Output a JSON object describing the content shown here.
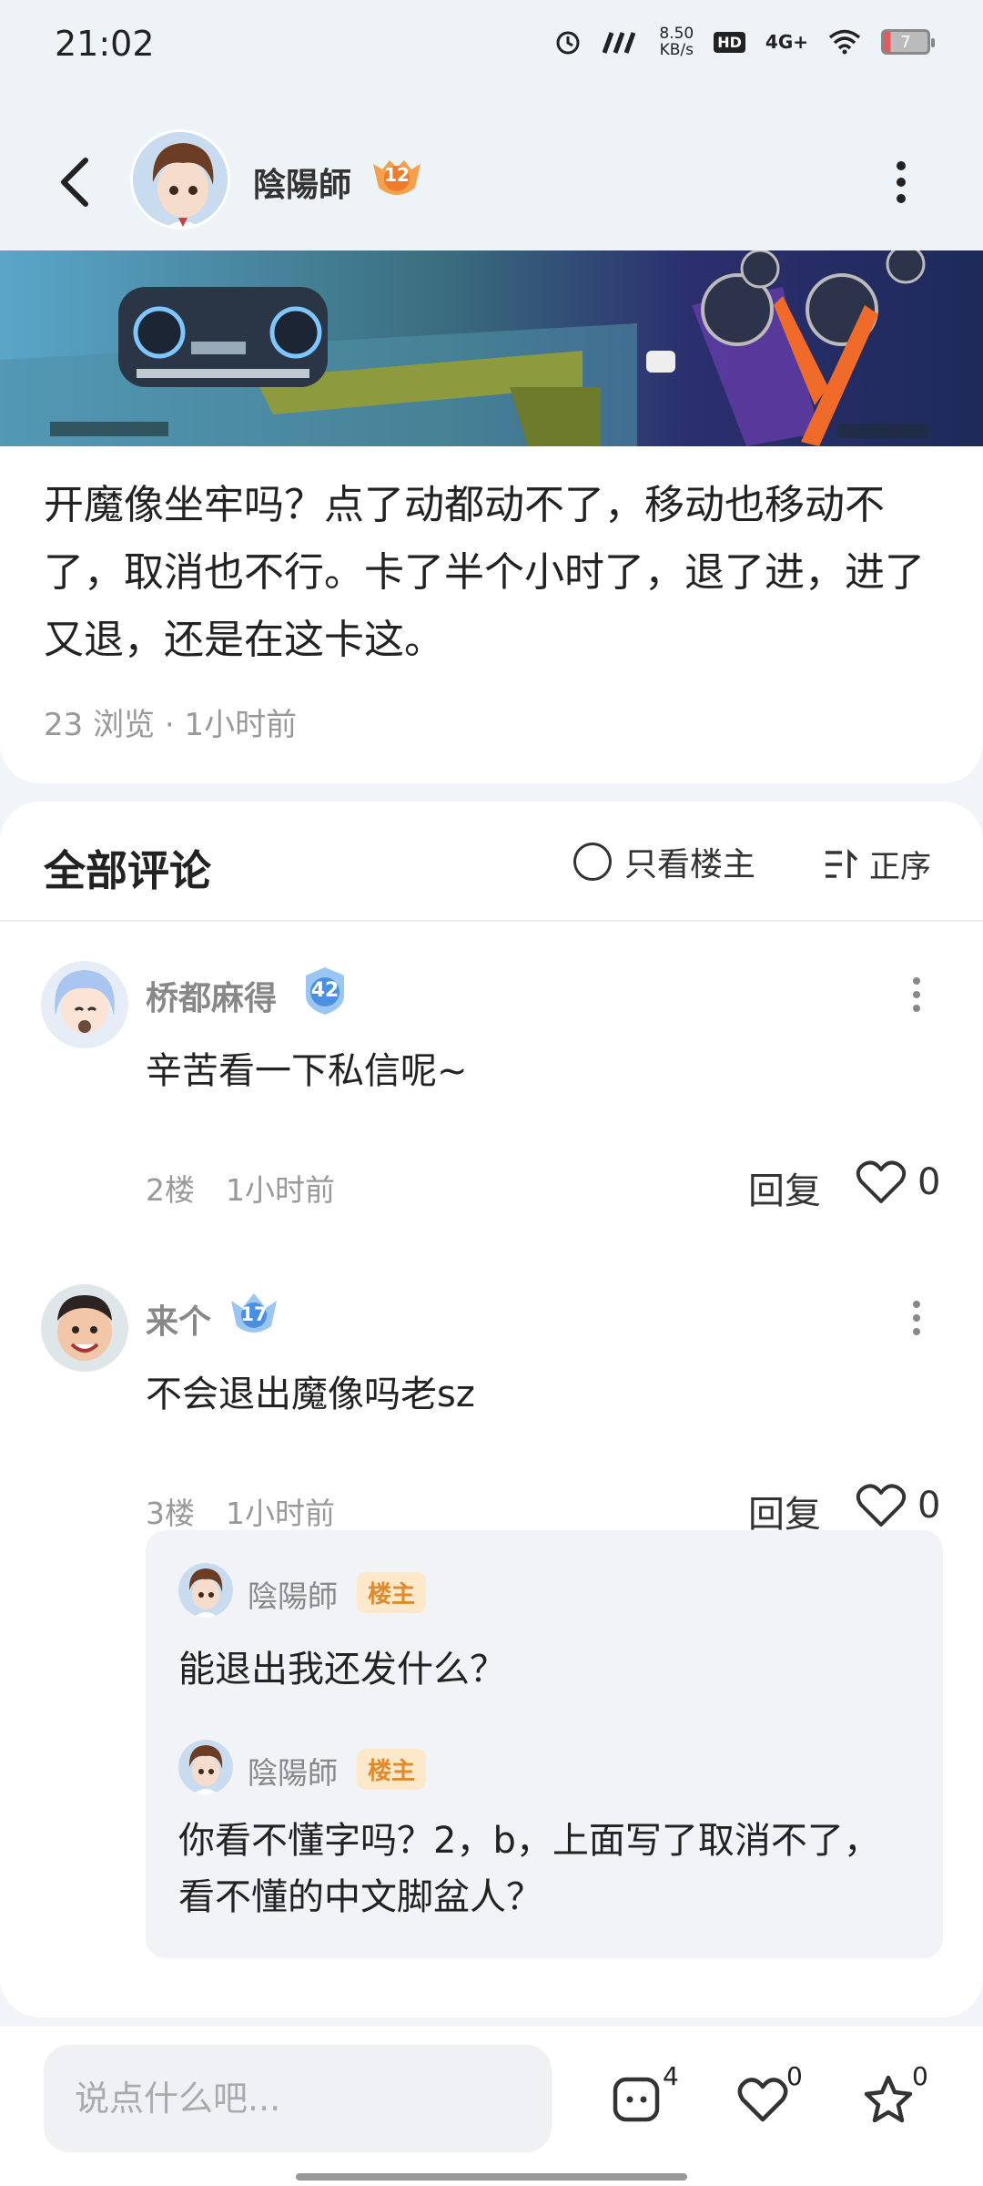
{
  "status_bar": {
    "time": "21:02",
    "speed": "8.50",
    "speed_unit": "KB/s",
    "hd": "HD",
    "network": "4G+",
    "battery": "7"
  },
  "header": {
    "username": "陰陽師",
    "level": "12"
  },
  "post": {
    "text": "开魔像坐牢吗？点了动都动不了，移动也移动不了，取消也不行。卡了半个小时了，退了进，进了又退，还是在这卡这。",
    "meta": "23 浏览 · 1小时前"
  },
  "comments_header": {
    "title": "全部评论",
    "only_op": "只看楼主",
    "sort": "正序"
  },
  "comments": [
    {
      "name": "桥都麻得",
      "level": "42",
      "text": "辛苦看一下私信呢~",
      "floor": "2楼",
      "time": "1小时前",
      "reply_label": "回复",
      "likes": "0"
    },
    {
      "name": "来个",
      "level": "17",
      "text": "不会退出魔像吗老sz",
      "floor": "3楼",
      "time": "1小时前",
      "reply_label": "回复",
      "likes": "0"
    }
  ],
  "replies": [
    {
      "name": "陰陽師",
      "tag": "楼主",
      "text": "能退出我还发什么？"
    },
    {
      "name": "陰陽師",
      "tag": "楼主",
      "text": "你看不懂字吗？2，b，上面写了取消不了，看不懂的中文脚盆人？"
    }
  ],
  "bottom_bar": {
    "placeholder": "说点什么吧...",
    "comment_count": "4",
    "like_count": "0",
    "star_count": "0"
  }
}
